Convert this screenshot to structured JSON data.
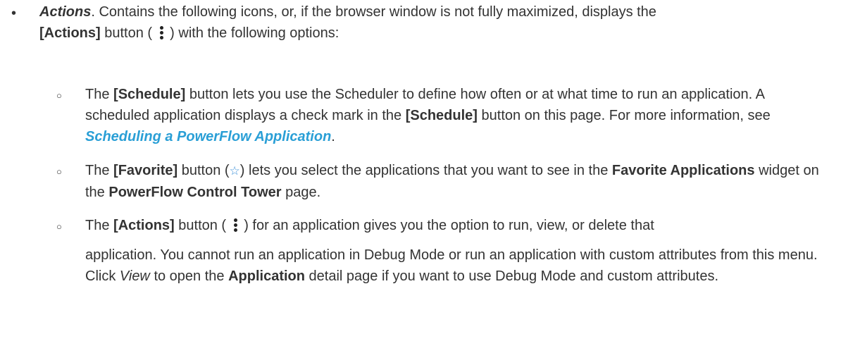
{
  "top": {
    "bullet": "•",
    "title": "Actions",
    "text_a": ". Contains the following icons, or, if the browser window is not fully maximized, displays the",
    "actions_label": "[Actions]",
    "text_b": " button ( ",
    "text_c": " ) with the following options:"
  },
  "items": [
    {
      "bullet": "○",
      "p1": "The ",
      "b1": "[Schedule]",
      "p2": " button lets you use the Scheduler to define how often or at what time to run an application. A scheduled application displays a check mark in the ",
      "b2": "[Schedule]",
      "p3": " button on this page. For more information, see ",
      "link": "Scheduling a PowerFlow Application",
      "p4": "."
    },
    {
      "bullet": "○",
      "p1": "The ",
      "b1": "[Favorite]",
      "p2": " button (",
      "star": "☆",
      "p3": ") lets you select the applications that you want to see in the ",
      "b2": "Favorite Applications",
      "p4": " widget on the ",
      "b3": "PowerFlow Control Tower",
      "p5": " page."
    },
    {
      "bullet": "○",
      "p1": "The ",
      "b1": "[Actions]",
      "p2": " button ( ",
      "p3": " ) for an application gives you the option to run, view, or delete that",
      "p4": "application. You cannot run an application in Debug Mode or run an application with custom attributes from this menu. Click ",
      "view": "View",
      "p5": " to open the ",
      "b2": "Application",
      "p6": " detail page if you want to use Debug Mode and custom attributes."
    }
  ],
  "icons": [
    "kebab-menu-icon",
    "star-icon"
  ],
  "colors": {
    "text": "#333333",
    "link": "#2a9fd6",
    "star": "#3a8fd8"
  }
}
